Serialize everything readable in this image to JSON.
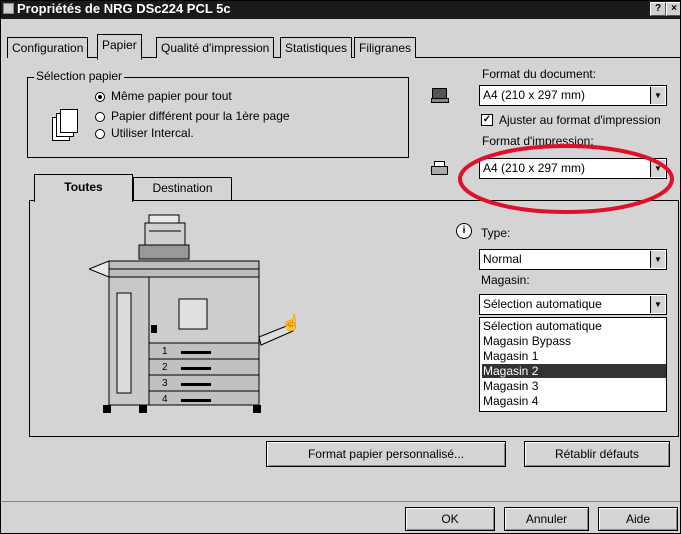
{
  "window": {
    "title": "Propriétés de NRG DSc224 PCL 5c",
    "help_button": "?",
    "close_button": "×"
  },
  "tabs": [
    {
      "label": "Configuration"
    },
    {
      "label": "Papier",
      "active": true
    },
    {
      "label": "Qualité d'impression"
    },
    {
      "label": "Statistiques"
    },
    {
      "label": "Filigranes"
    }
  ],
  "paper_selection": {
    "legend": "Sélection papier",
    "options": [
      {
        "label": "Même papier pour tout",
        "selected": true
      },
      {
        "label": "Papier différent pour la 1ère page",
        "selected": false
      },
      {
        "label": "Utiliser Intercal.",
        "selected": false
      }
    ]
  },
  "document_format": {
    "label": "Format du document:",
    "value": "A4 (210 x 297 mm)"
  },
  "fit_to_print_format": {
    "label": "Ajuster au format d'impression",
    "checked": true
  },
  "print_format": {
    "label": "Format d'impression:",
    "value": "A4 (210 x 297 mm)"
  },
  "subtabs": [
    {
      "label": "Toutes",
      "active": true
    },
    {
      "label": "Destination",
      "active": false
    }
  ],
  "type": {
    "label": "Type:",
    "value": "Normal"
  },
  "tray": {
    "label": "Magasin:",
    "value": "Sélection automatique",
    "options": [
      "Sélection automatique",
      "Magasin Bypass",
      "Magasin 1",
      "Magasin 2",
      "Magasin 3",
      "Magasin 4"
    ],
    "highlighted": "Magasin 2"
  },
  "printer_trays": [
    "1",
    "2",
    "3",
    "4"
  ],
  "buttons": {
    "custom_format": "Format papier personnalisé...",
    "reset_defaults": "Rétablir défauts",
    "ok": "OK",
    "cancel": "Annuler",
    "help": "Aide"
  },
  "colors": {
    "highlight_ellipse": "#e0102a",
    "selection": "#333333",
    "dialog_bg": "#d4d4d4"
  }
}
